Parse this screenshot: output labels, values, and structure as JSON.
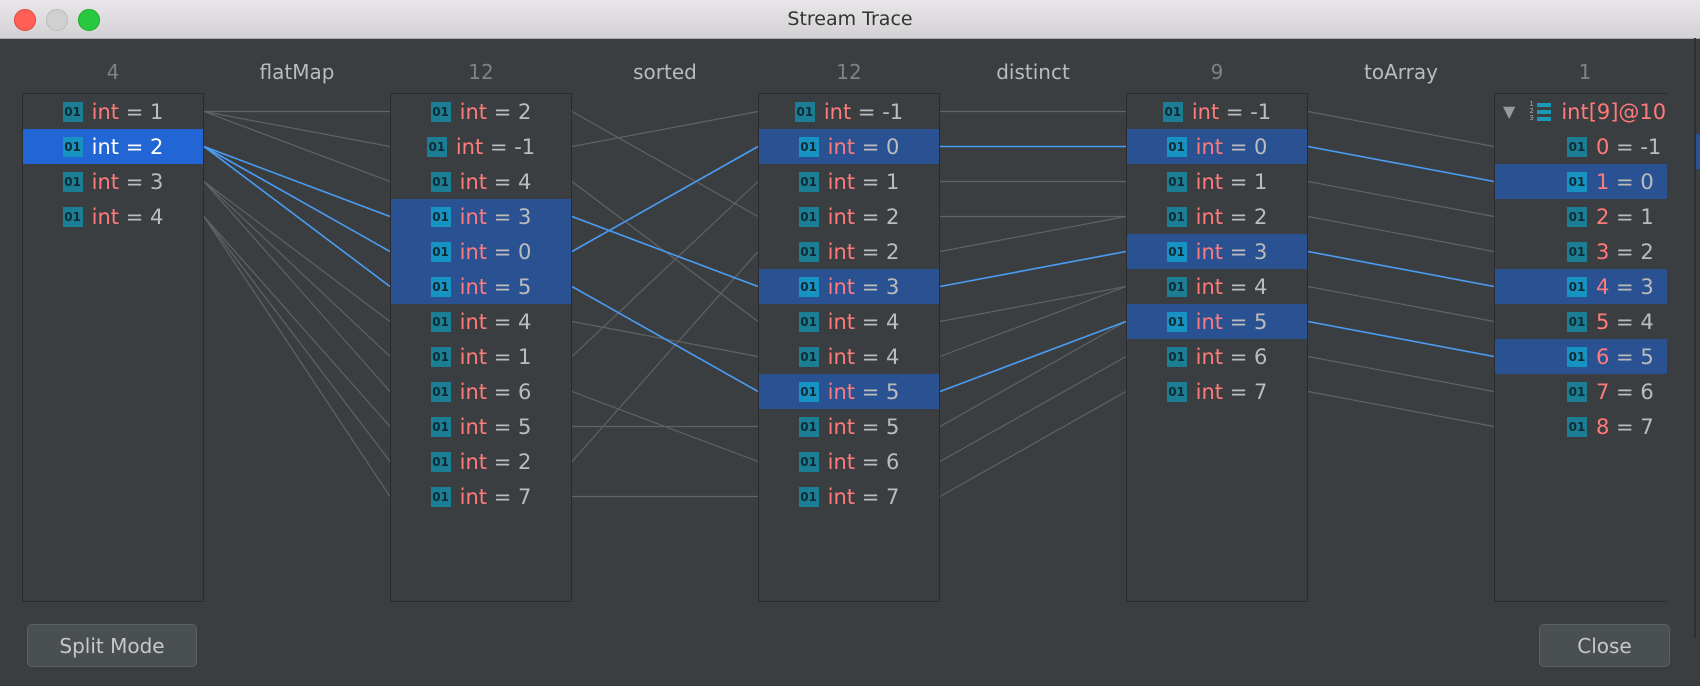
{
  "window": {
    "title": "Stream Trace"
  },
  "colors": {
    "selected_row": "#2a5292",
    "primary_row": "#2266d5",
    "link_gray": "#606265",
    "link_blue": "#4a9cf5",
    "keyword": "#ff7b7b"
  },
  "columns": [
    {
      "count": "4",
      "items": [
        "1",
        "2",
        "3",
        "4"
      ],
      "selected": [
        1
      ],
      "primary": 1
    },
    {
      "count": "12",
      "items": [
        "2",
        "-1",
        "4",
        "3",
        "0",
        "5",
        "4",
        "1",
        "6",
        "5",
        "2",
        "7"
      ],
      "selected": [
        3,
        4,
        5
      ]
    },
    {
      "count": "12",
      "items": [
        "-1",
        "0",
        "1",
        "2",
        "2",
        "3",
        "4",
        "4",
        "5",
        "5",
        "6",
        "7"
      ],
      "selected": [
        1,
        5,
        8
      ]
    },
    {
      "count": "9",
      "items": [
        "-1",
        "0",
        "1",
        "2",
        "3",
        "4",
        "5",
        "6",
        "7"
      ],
      "selected": [
        1,
        4,
        6
      ]
    },
    {
      "count": "1",
      "array_label": "int[9]@10",
      "items": [
        "-1",
        "0",
        "1",
        "2",
        "3",
        "4",
        "5",
        "6",
        "7"
      ],
      "selected": [
        1,
        4,
        6
      ]
    }
  ],
  "operations": [
    "flatMap",
    "sorted",
    "distinct",
    "toArray"
  ],
  "type_label": "int",
  "icon": "01",
  "links": [
    [
      [
        0,
        0
      ],
      [
        0,
        1
      ],
      [
        0,
        2
      ],
      [
        1,
        3
      ],
      [
        1,
        4
      ],
      [
        1,
        5
      ],
      [
        2,
        6
      ],
      [
        2,
        7
      ],
      [
        2,
        8
      ],
      [
        3,
        9
      ],
      [
        3,
        10
      ],
      [
        3,
        11
      ]
    ],
    [
      [
        0,
        3
      ],
      [
        1,
        0
      ],
      [
        2,
        6
      ],
      [
        3,
        5
      ],
      [
        4,
        1
      ],
      [
        5,
        8
      ],
      [
        6,
        7
      ],
      [
        7,
        2
      ],
      [
        8,
        10
      ],
      [
        9,
        9
      ],
      [
        10,
        4
      ],
      [
        11,
        11
      ]
    ],
    [
      [
        0,
        0
      ],
      [
        1,
        1
      ],
      [
        2,
        2
      ],
      [
        3,
        3
      ],
      [
        4,
        3
      ],
      [
        5,
        4
      ],
      [
        6,
        5
      ],
      [
        7,
        5
      ],
      [
        8,
        6
      ],
      [
        9,
        6
      ],
      [
        10,
        7
      ],
      [
        11,
        8
      ]
    ],
    [
      [
        0,
        1
      ],
      [
        1,
        2
      ],
      [
        2,
        3
      ],
      [
        3,
        4
      ],
      [
        4,
        5
      ],
      [
        5,
        6
      ],
      [
        6,
        7
      ],
      [
        7,
        8
      ],
      [
        8,
        9
      ]
    ]
  ],
  "buttons": {
    "split_mode": "Split Mode",
    "close": "Close"
  }
}
